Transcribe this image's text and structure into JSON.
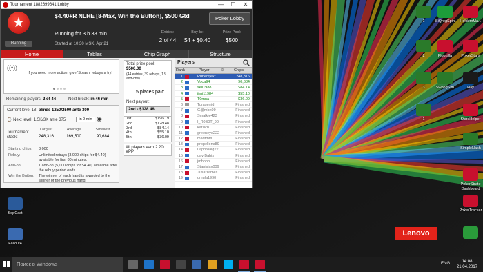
{
  "window": {
    "title": "Tournament 1882699641 Lobby",
    "close_glyph": "✕",
    "minimize_glyph": "—",
    "maximize_glyph": "☐"
  },
  "header": {
    "title": "$4.40+R NLHE [8-Max, Win the Button], $500 Gtd",
    "running_for": "Running for 3 h 38 min",
    "started": "Started at 10:30 MSK, Apr 21",
    "status_badge": "Running",
    "poker_lobby_button": "Poker Lobby",
    "entries_label": "Entries:",
    "entries_value": "2 of 44",
    "buyin_label": "Buy-In:",
    "buyin_value": "$4 + $0.40",
    "prizepool_label": "Prize Pool:",
    "prizepool_value": "$500"
  },
  "tabs": [
    "Home",
    "Tables",
    "Chip Graph",
    "Structure"
  ],
  "promo": {
    "message": "If you need more action, give 'Splash' rebuys a try!"
  },
  "stats": {
    "remaining_label": "Remaining players:",
    "remaining_value": "2 of 44",
    "next_break_label": "Next break:",
    "next_break_value": "in 46 min",
    "current_level_label": "Current level 18:",
    "current_level_value": "blinds 1250/2500 ante 300",
    "next_level_label": "Next level:",
    "next_level_value": "1.5K/3K ante 375",
    "next_level_timer": "in 9 min",
    "earn_label": "Tournament stack:",
    "largest_label": "Largest",
    "largest_value": "248,316",
    "average_label": "Average",
    "average_value": "169,500",
    "smallest_label": "Smallest",
    "smallest_value": "90,684"
  },
  "info": {
    "starting_chips_label": "Starting chips:",
    "starting_chips_value": "3,000",
    "rebuy_label": "Rebuy:",
    "rebuy_value": "Unlimited rebuys (3,000 chips for $4.40) available for first 80 minutes.",
    "addon_label": "Add-on:",
    "addon_value": "1 add-on (5,000 chips for $4.40) available after the rebuy period ends.",
    "wtb_label": "Win the Button:",
    "wtb_value": "The winner of each hand is awarded to the winner of the previous hand."
  },
  "pool": {
    "total_label": "Total prize pool:",
    "total_value": "$500.00",
    "detail": "(44 entries, 39 rebuys, 18 add-ons)",
    "places_paid": "5 places paid",
    "next_payout_label": "Next payout:",
    "next_payout_value": "2nd - $128.48",
    "payouts": [
      {
        "place": "1st",
        "amount": "$196.19"
      },
      {
        "place": "2nd",
        "amount": "$128.48"
      },
      {
        "place": "3rd",
        "amount": "$84.14"
      },
      {
        "place": "4th",
        "amount": "$55.10"
      },
      {
        "place": "5th",
        "amount": "$36.09"
      }
    ],
    "bounty_text": "All players earn 2.20 VPP"
  },
  "players": {
    "title": "Players",
    "col_rank": "Rank",
    "col_player": "Player",
    "col_chips": "Chips",
    "rows": [
      {
        "rank": "1",
        "name": "Rubentjekr",
        "chips": "248,316",
        "state": "hl",
        "flag": "#c8102e"
      },
      {
        "rank": "2",
        "name": "Voca94",
        "chips": "90,684",
        "state": "active",
        "flag": "#2a6cc6"
      },
      {
        "rank": "3",
        "name": "sell1988",
        "chips": "$84.14",
        "state": "active",
        "flag": "#2a6cc6"
      },
      {
        "rank": "4",
        "name": "jimi11984",
        "chips": "$55.10",
        "state": "active",
        "flag": "#2a6cc6"
      },
      {
        "rank": "5",
        "name": "T0mna",
        "chips": "$36.09",
        "state": "active",
        "flag": "#c8102e"
      },
      {
        "rank": "6",
        "name": "Toraserrid",
        "chips": "Finished",
        "state": "busted",
        "flag": "#999999"
      },
      {
        "rank": "7",
        "name": "G@mbn09",
        "chips": "Finished",
        "state": "busted",
        "flag": "#2a6cc6"
      },
      {
        "rank": "8",
        "name": "Smalkie423",
        "chips": "Finished",
        "state": "busted",
        "flag": "#c8102e"
      },
      {
        "rank": "9",
        "name": "I_R0B0T_90",
        "chips": "Finished",
        "state": "busted",
        "flag": "#2a6cc6"
      },
      {
        "rank": "10",
        "name": "kariilch",
        "chips": "Finished",
        "state": "busted",
        "flag": "#c8102e"
      },
      {
        "rank": "11",
        "name": "greeneye222",
        "chips": "Finished",
        "state": "busted",
        "flag": "#2a6cc6"
      },
      {
        "rank": "12",
        "name": "madtmm",
        "chips": "Finished",
        "state": "busted",
        "flag": "#c8102e"
      },
      {
        "rank": "13",
        "name": "propellona89",
        "chips": "Finished",
        "state": "busted",
        "flag": "#2a6cc6"
      },
      {
        "rank": "14",
        "name": "Laphroaig22",
        "chips": "Finished",
        "state": "busted",
        "flag": "#c8102e"
      },
      {
        "rank": "15",
        "name": "dav Babis",
        "chips": "Finished",
        "state": "busted",
        "flag": "#2a6cc6"
      },
      {
        "rank": "16",
        "name": "jmboboi",
        "chips": "Finished",
        "state": "busted",
        "flag": "#c8102e"
      },
      {
        "rank": "17",
        "name": "Stanislav006",
        "chips": "Finished",
        "state": "busted",
        "flag": "#2a6cc6"
      },
      {
        "rank": "18",
        "name": "Jusatzames",
        "chips": "Finished",
        "state": "busted",
        "flag": "#c8102e"
      },
      {
        "rank": "19",
        "name": "dmula1990",
        "chips": "Finished",
        "state": "busted",
        "flag": "#2a6cc6"
      }
    ]
  },
  "desktop": {
    "icons": [
      {
        "id": "d1",
        "label": "1",
        "color": "#2a7a2a"
      },
      {
        "id": "d2",
        "label": "SiQregSpin",
        "color": "#1d9c3a"
      },
      {
        "id": "d3",
        "label": "HoldemMa...",
        "color": "#c8102e"
      },
      {
        "id": "d4",
        "label": "2",
        "color": "#2a7a2a"
      },
      {
        "id": "d5",
        "label": "Flopzilla",
        "color": "#c8102e"
      },
      {
        "id": "d6",
        "label": "PokerStars",
        "color": "#c8102e"
      },
      {
        "id": "d7",
        "label": "3",
        "color": "#2a7a2a"
      },
      {
        "id": "d8",
        "label": "SwongSim",
        "color": "#2a7a2a"
      },
      {
        "id": "d9",
        "label": "Hay",
        "color": "#1a1a1a"
      },
      {
        "id": "d10",
        "label": "1",
        "color": "#2a7a2a"
      },
      {
        "id": "d11",
        "label": "StarsHelper",
        "color": "#c8102e"
      },
      {
        "id": "d12",
        "label": "SimpleNash",
        "color": "#2a7a2a"
      },
      {
        "id": "d13",
        "label": "PokerStrate Dashboard",
        "color": "#c8102e"
      },
      {
        "id": "d14",
        "label": "PokerTracker",
        "color": "#c8102e"
      },
      {
        "id": "d15",
        "label": "SopCast",
        "color": "#2a5a9a"
      },
      {
        "id": "d16",
        "label": "Fallout4",
        "color": "#3a6ab0"
      },
      {
        "id": "d17",
        "label": "",
        "color": "#2a9a3a"
      }
    ],
    "brand": "Lenovo"
  },
  "taskbar": {
    "search_placeholder": "Поиск в Windows",
    "language": "ENG",
    "time": "14:08",
    "date": "21.04.2017",
    "apps": [
      {
        "name": "task-view-app",
        "color": "#666666"
      },
      {
        "name": "edge-app",
        "color": "#1e73c8"
      },
      {
        "name": "mail-app",
        "color": "#c8102e"
      },
      {
        "name": "calculator-app",
        "color": "#444444"
      },
      {
        "name": "store-app",
        "color": "#3a6ab0"
      },
      {
        "name": "chrome-app",
        "color": "#e0a020"
      },
      {
        "name": "skype-app",
        "color": "#00aff0"
      },
      {
        "name": "pokerstars-app",
        "color": "#c8102e"
      },
      {
        "name": "pokerstars2-app",
        "color": "#c8102e"
      }
    ]
  }
}
